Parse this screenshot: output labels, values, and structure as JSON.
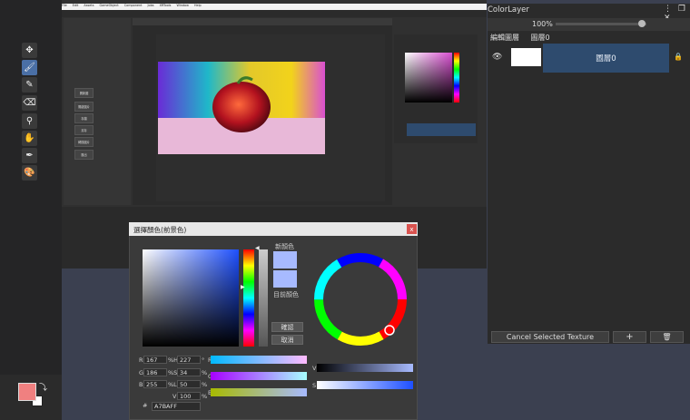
{
  "colors": {
    "foreground": "#f08080",
    "background": "#ffffff",
    "picked": "#a7baff",
    "layer_selected": "#2e4b6e"
  },
  "toolbar": {
    "tools": [
      "move-icon",
      "brush-icon",
      "pencil-icon",
      "eraser-icon",
      "zoom-icon",
      "hand-icon",
      "eyedropper-icon",
      "palette-icon"
    ],
    "active": "brush-icon"
  },
  "editor": {
    "menu": [
      "File",
      "Edit",
      "Assets",
      "GameObject",
      "Component",
      "Jobs",
      "XRTools",
      "Window",
      "Help"
    ],
    "side_buttons": [
      "開新圖",
      "開啟圖片",
      "存檔",
      "另存",
      "轉換圖片",
      "匯出"
    ]
  },
  "layers_panel": {
    "title": "ColorLayer",
    "opacity": "100%",
    "edit_layer": "編輯圖層",
    "layer_label": "圖層0",
    "layer_name": "圖層0",
    "cancel_texture": "Cancel Selected Texture",
    "add": "+",
    "delete": "🗑"
  },
  "picker": {
    "title": "選擇顏色(前景色)",
    "close": "x",
    "new_color_label": "新顏色",
    "current_color_label": "目前顏色",
    "ok": "確認",
    "cancel": "取消",
    "fields": {
      "R": "167",
      "G": "186",
      "B": "255",
      "H": "227",
      "S": "34",
      "L": "50",
      "V": "100"
    },
    "hex_label": "#",
    "hex": "A7BAFF"
  }
}
